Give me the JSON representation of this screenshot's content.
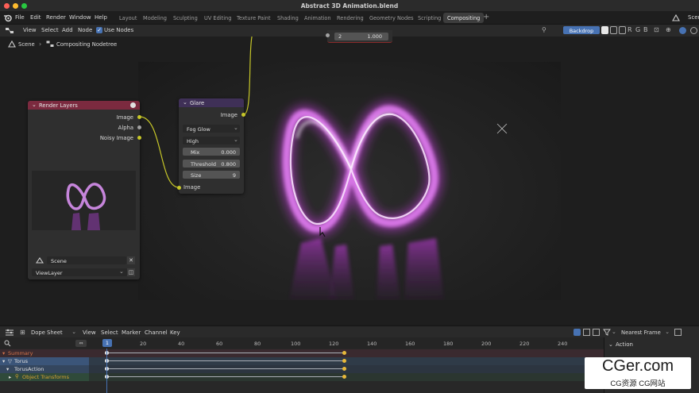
{
  "window": {
    "title": "Abstract 3D Animation.blend"
  },
  "menu": [
    "File",
    "Edit",
    "Render",
    "Window",
    "Help"
  ],
  "workspaces": [
    "Layout",
    "Modeling",
    "Sculpting",
    "UV Editing",
    "Texture Paint",
    "Shading",
    "Animation",
    "Rendering",
    "Geometry Nodes",
    "Scripting",
    "Compositing"
  ],
  "active_workspace": "Compositing",
  "scene_label": "Scene",
  "editor_menu": [
    "View",
    "Select",
    "Add",
    "Node"
  ],
  "use_nodes_label": "Use Nodes",
  "backdrop_label": "Backdrop",
  "channel_letters": [
    "R",
    "G",
    "B"
  ],
  "breadcrumb": {
    "scene": "Scene",
    "tree": "Compositing Nodetree"
  },
  "partial_node": {
    "a": "2",
    "b": "1.000"
  },
  "render_layers": {
    "title": "Render Layers",
    "outputs": [
      "Image",
      "Alpha",
      "Noisy Image"
    ],
    "scene": "Scene",
    "view_layer": "ViewLayer"
  },
  "glare": {
    "title": "Glare",
    "output": "Image",
    "type": "Fog Glow",
    "quality": "High",
    "fields": [
      {
        "label": "Mix",
        "value": "0.000"
      },
      {
        "label": "Threshold",
        "value": "0.800"
      },
      {
        "label": "Size",
        "value": "9"
      }
    ],
    "input": "Image"
  },
  "dopesheet": {
    "mode": "Dope Sheet",
    "menu": [
      "View",
      "Select",
      "Marker",
      "Channel",
      "Key"
    ],
    "snap": "Nearest Frame",
    "current_frame": "1",
    "ticks": [
      "20",
      "40",
      "60",
      "80",
      "100",
      "120",
      "140",
      "160",
      "180",
      "200",
      "220",
      "240"
    ],
    "channels": [
      "Summary",
      "Torus",
      "TorusAction",
      "Object Transforms"
    ],
    "side_panel": "Action"
  },
  "watermark": {
    "main": "CGer.com",
    "sub": "CG资源 CG网站"
  },
  "colors": {
    "accent_blue": "#4772b3",
    "glow_magenta": "#d34fe0",
    "render_layers_header": "#7b2a3f",
    "glare_header": "#3f3057",
    "socket_yellow": "#c7c729"
  }
}
